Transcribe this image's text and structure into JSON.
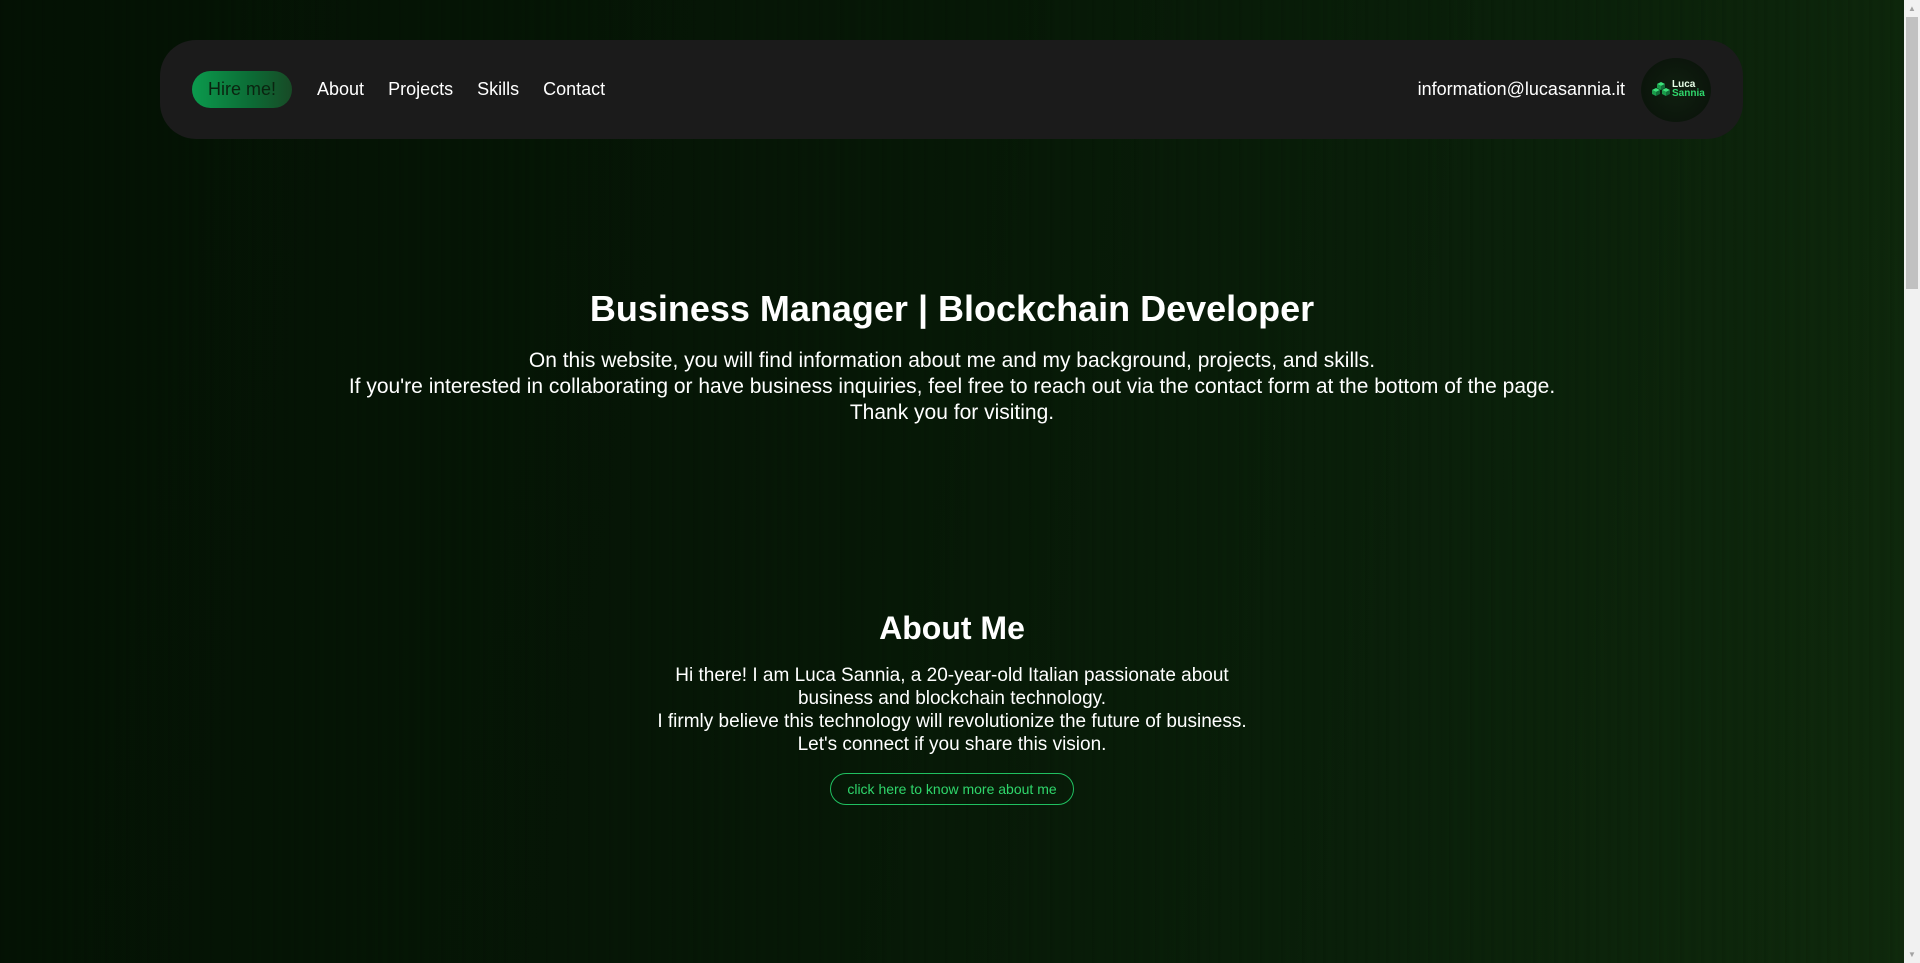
{
  "nav": {
    "hire_label": "Hire me!",
    "links": [
      "About",
      "Projects",
      "Skills",
      "Contact"
    ],
    "email": "information@lucasannia.it",
    "logo": {
      "line1": "Luca",
      "line2": "Sannia",
      "icon": "cube-logo-icon"
    }
  },
  "hero": {
    "title": "Business Manager | Blockchain Developer",
    "lines": [
      "On this website, you will find information about me and my background, projects, and skills.",
      "If you're interested in collaborating or have business inquiries, feel free to reach out via the contact form at the bottom of the page.",
      "Thank you for visiting."
    ]
  },
  "about": {
    "title": "About Me",
    "lines": [
      "Hi there! I am Luca Sannia, a 20-year-old Italian passionate about",
      "business and blockchain technology.",
      "I firmly believe this technology will revolutionize the future of business.",
      "Let's connect if you share this vision."
    ],
    "button_label": "click here to know more about me"
  },
  "colors": {
    "accent_green": "#2fd66b",
    "navbar_bg": "#1b1b1b",
    "background": "#061806"
  }
}
